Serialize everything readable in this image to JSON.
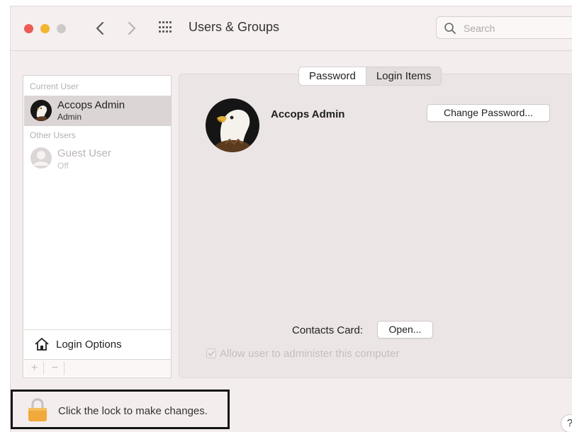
{
  "window": {
    "title": "Users & Groups",
    "search_placeholder": "Search"
  },
  "userlist": {
    "current_header": "Current User",
    "other_header": "Other Users",
    "users": [
      {
        "name": "Accops Admin",
        "role": "Admin",
        "selected": true,
        "avatar": "eagle-avatar-icon"
      },
      {
        "name": "Guest User",
        "role": "Off",
        "selected": false,
        "avatar": "generic-user-icon"
      }
    ],
    "login_options_label": "Login Options",
    "add_label": "+",
    "remove_label": "−"
  },
  "tabs": [
    {
      "label": "Password",
      "active": true
    },
    {
      "label": "Login Items",
      "active": false
    }
  ],
  "detail": {
    "full_name": "Accops Admin",
    "change_password_label": "Change Password...",
    "contacts_card_label": "Contacts Card:",
    "open_label": "Open...",
    "allow_admin_label": "Allow user to administer this computer",
    "allow_admin_checked": true,
    "allow_admin_enabled": false
  },
  "footer": {
    "lock_text": "Click the lock to make changes.",
    "help_label": "?"
  },
  "colors": {
    "close": "#ec5b56",
    "minimize": "#f2b52e",
    "lock": "#f0a93a",
    "selection": "#dcd5d5"
  }
}
